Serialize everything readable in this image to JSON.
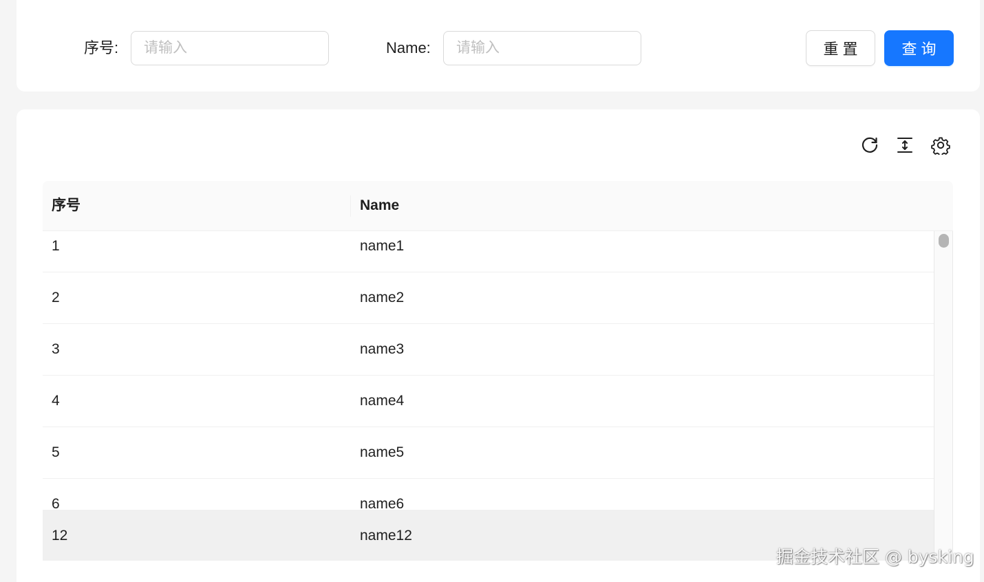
{
  "search": {
    "fields": [
      {
        "label": "序号:",
        "placeholder": "请输入",
        "value": ""
      },
      {
        "label": "Name:",
        "placeholder": "请输入",
        "value": ""
      }
    ],
    "reset_label": "重置",
    "query_label": "查询"
  },
  "toolbar": {
    "icons": [
      "reload-icon",
      "column-height-icon",
      "setting-icon"
    ]
  },
  "table": {
    "columns": [
      "序号",
      "Name"
    ],
    "rows": [
      {
        "id": "1",
        "name": "name1"
      },
      {
        "id": "2",
        "name": "name2"
      },
      {
        "id": "3",
        "name": "name3"
      },
      {
        "id": "4",
        "name": "name4"
      },
      {
        "id": "5",
        "name": "name5"
      },
      {
        "id": "6",
        "name": "name6"
      }
    ],
    "summary_row": {
      "id": "12",
      "name": "name12"
    }
  },
  "colors": {
    "primary": "#1677ff",
    "header_bg": "#fafafa",
    "summary_bg": "#f0f0f0",
    "border": "#d9d9d9"
  },
  "watermark": "掘金技术社区 @ bysking"
}
